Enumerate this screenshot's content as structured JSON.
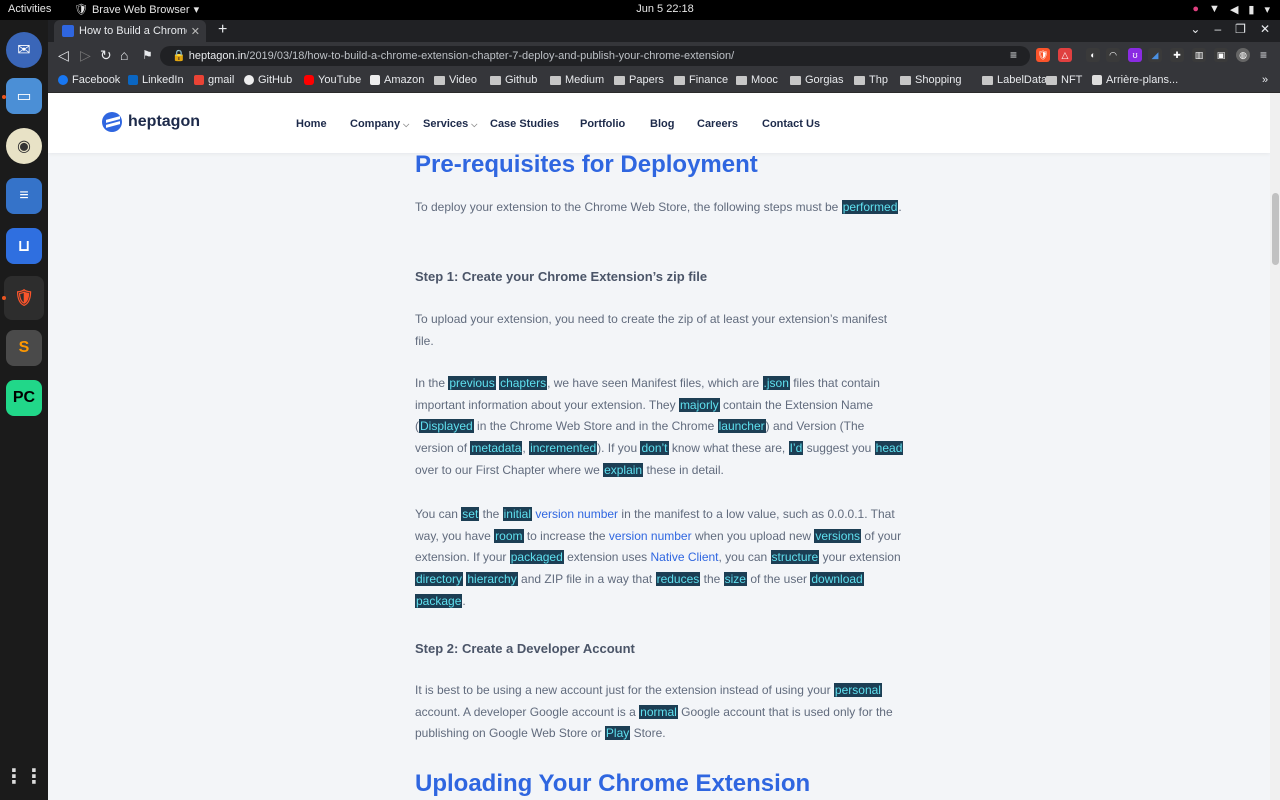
{
  "system": {
    "activities": "Activities",
    "app_name": "Brave Web Browser",
    "clock": "Jun 5  22:18"
  },
  "browser": {
    "tab_title": "How to Build a Chrome Ex",
    "url_domain": "heptagon.in",
    "url_path": "/2019/03/18/how-to-build-a-chrome-extension-chapter-7-deploy-and-publish-your-chrome-extension/",
    "bookmarks": [
      "Facebook",
      "LinkedIn",
      "gmail",
      "GitHub",
      "YouTube",
      "Amazon",
      "Video",
      "Github",
      "Medium",
      "Papers",
      "Finance",
      "Mooc",
      "Gorgias",
      "Thp",
      "Shopping",
      "LabelData",
      "NFT",
      "Arrière-plans..."
    ],
    "colors": {
      "accent": "#2f66e0",
      "highlight_bg": "#1c3e54",
      "highlight_fg": "#5fe0ef"
    }
  },
  "site": {
    "logo": "heptagon",
    "nav": [
      "Home",
      "Company",
      "Services",
      "Case Studies",
      "Portfolio",
      "Blog",
      "Careers",
      "Contact Us"
    ]
  },
  "article": {
    "heading1": "Pre-requisites for Deployment",
    "p1": "To deploy your extension to the Chrome Web Store, the following steps must be performed.",
    "step1": "Step 1: Create your Chrome Extension’s zip file",
    "p2": "To upload your extension, you need to create the zip of at least your extension’s manifest file.",
    "p3": "In the previous chapters, we have seen Manifest files, which are .json files that contain important information about your extension. They majorly contain the Extension Name (Displayed in the Chrome Web Store and in the Chrome launcher) and Version (The version of metadata, incremented). If you don’t know what these are, I’d suggest you head over to our First Chapter where we explain these in detail.",
    "p4": "You can set the initial version number in the manifest to a low value, such as 0.0.0.1. That way, you have room to increase the version number when you upload new versions of your extension. If your packaged extension uses Native Client, you can structure your extension directory hierarchy and ZIP file in a way that reduces the size of the user download package.",
    "step2": "Step 2: Create a Developer Account",
    "p5": "It is best to be using a new account just for the extension instead of using your personal account. A developer Google account is a normal Google account that is used only for the publishing on Google Web Store or Play Store.",
    "heading2": "Uploading Your Chrome Extension"
  }
}
